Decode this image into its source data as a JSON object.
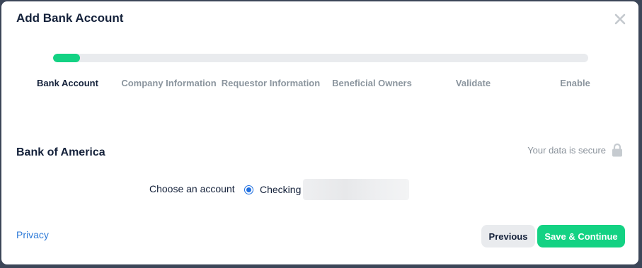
{
  "modal": {
    "title": "Add Bank Account",
    "close_icon": "close-icon"
  },
  "progress": {
    "fraction": 0.05,
    "fill_color": "#13d283",
    "track_color": "#e9ebee"
  },
  "steps": [
    {
      "label": "Bank Account",
      "active": true
    },
    {
      "label": "Company Information",
      "active": false
    },
    {
      "label": "Requestor Information",
      "active": false
    },
    {
      "label": "Beneficial Owners",
      "active": false
    },
    {
      "label": "Validate",
      "active": false
    },
    {
      "label": "Enable",
      "active": false
    }
  ],
  "bank": {
    "name": "Bank of America",
    "secure_text": "Your data is secure",
    "secure_icon": "lock-icon"
  },
  "account": {
    "label": "Choose an account",
    "selected_type": "Checking",
    "selected": true
  },
  "footer": {
    "privacy_link": "Privacy",
    "previous_button": "Previous",
    "save_button": "Save & Continue"
  },
  "colors": {
    "accent": "#13d283",
    "link": "#2f7bd8",
    "radio": "#1f6fe0",
    "text_primary": "#14213a",
    "text_muted": "#8b959e"
  }
}
